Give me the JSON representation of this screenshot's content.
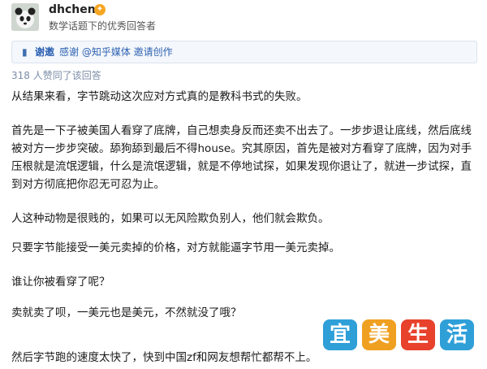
{
  "author": {
    "name": "dhchen",
    "description": "数学话题下的优秀回答者"
  },
  "invite": {
    "prefix": "谢邀",
    "text": "感谢 @知乎媒体 邀请创作"
  },
  "votes_text": "318 人赞同了该回答",
  "paragraphs": [
    "从结果来看，字节跳动这次应对方式真的是教科书式的失败。",
    "首先是一下子被美国人看穿了底牌，自己想卖身反而还卖不出去了。一步步退让底线，然后底线被对方一步步突破。舔狗舔到最后不得house。究其原因，首先是被对方看穿了底牌，因为对手压根就是流氓逻辑，什么是流氓逻辑，就是不停地试探，如果发现你退让了，就进一步试探，直到对方彻底把你忍无可忍为止。",
    "人这种动物是很贱的，如果可以无风险欺负别人，他们就会欺负。",
    "只要字节能接受一美元卖掉的价格，对方就能逼字节用一美元卖掉。",
    "谁让你被看穿了呢？",
    "卖就卖了呗，一美元也是美元，不然就没了哦？",
    "然后字节跑的速度太快了，快到中国zf和网友想帮忙都帮不上。"
  ],
  "watermark": {
    "chars": [
      "宜",
      "美",
      "生",
      "活"
    ],
    "colors": [
      "#2f9fd8",
      "#f0a020",
      "#e8412c",
      "#2f9fd8"
    ]
  },
  "colors": {
    "link_blue": "#2d62b3",
    "badge": "#f5a623"
  }
}
